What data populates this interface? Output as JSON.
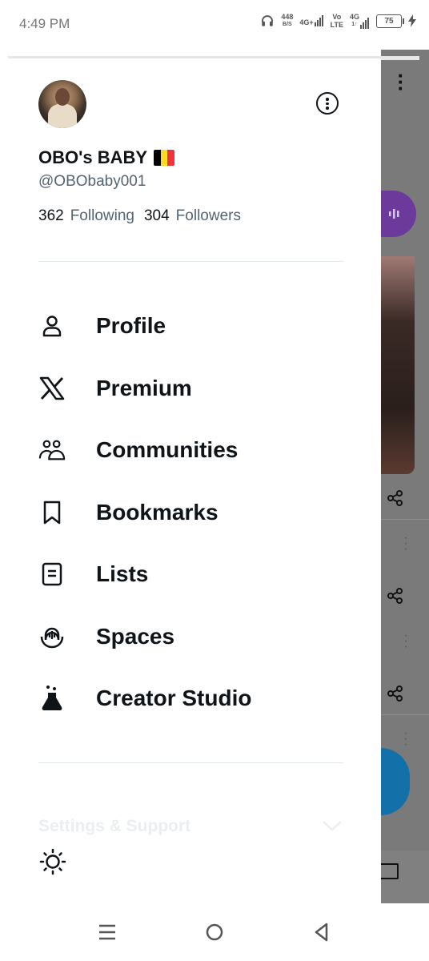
{
  "status_bar": {
    "time": "4:49 PM",
    "net_speed_top": "448",
    "net_speed_bottom": "B/S",
    "net1_top": "4G+",
    "net2_top": "Vo",
    "net2_bottom": "LTE",
    "net3_top": "4G",
    "net3_bottom": "1↑",
    "battery": "75"
  },
  "profile": {
    "display_name": "OBO's BABY",
    "handle": "@OBObaby001",
    "following_count": "362",
    "following_label": "Following",
    "followers_count": "304",
    "followers_label": "Followers",
    "flag_colors": [
      "#000000",
      "#fdda24",
      "#ef3340"
    ]
  },
  "menu": {
    "items": [
      {
        "label": "Profile",
        "icon": "person-icon"
      },
      {
        "label": "Premium",
        "icon": "x-logo-icon"
      },
      {
        "label": "Communities",
        "icon": "communities-icon"
      },
      {
        "label": "Bookmarks",
        "icon": "bookmark-icon"
      },
      {
        "label": "Lists",
        "icon": "list-icon"
      },
      {
        "label": "Spaces",
        "icon": "spaces-icon"
      },
      {
        "label": "Creator Studio",
        "icon": "flask-icon"
      }
    ]
  },
  "footer": {
    "settings_label": "Settings & Support"
  },
  "colors": {
    "text_primary": "#0f1419",
    "text_secondary": "#536471",
    "divider": "#e1e8ec"
  }
}
